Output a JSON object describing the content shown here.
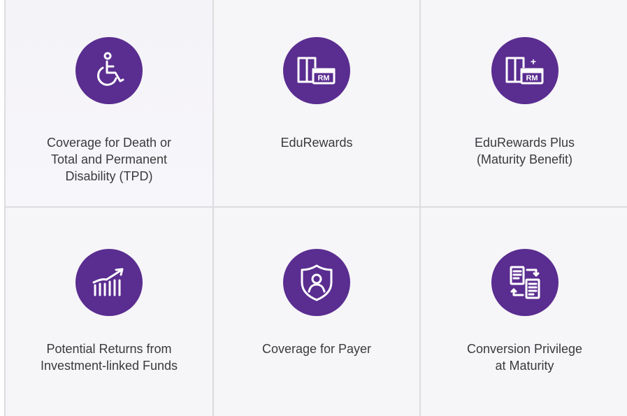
{
  "features": [
    {
      "label": "Coverage for Death or\nTotal and Permanent\nDisability (TPD)",
      "icon": "wheelchair-icon"
    },
    {
      "label": "EduRewards",
      "icon": "book-rm-icon"
    },
    {
      "label": "EduRewards Plus\n(Maturity Benefit)",
      "icon": "book-rm-plus-icon"
    },
    {
      "label": "Potential Returns from\nInvestment-linked Funds",
      "icon": "growth-chart-icon"
    },
    {
      "label": "Coverage for Payer",
      "icon": "shield-person-icon"
    },
    {
      "label": "Conversion Privilege\nat Maturity",
      "icon": "document-exchange-icon"
    }
  ],
  "icon_text": {
    "rm": "RM",
    "plus": "+"
  },
  "colors": {
    "accent": "#5a2d90",
    "text": "#3a3a3c",
    "border": "#dcdcdf",
    "background": "#f6f5f8"
  }
}
